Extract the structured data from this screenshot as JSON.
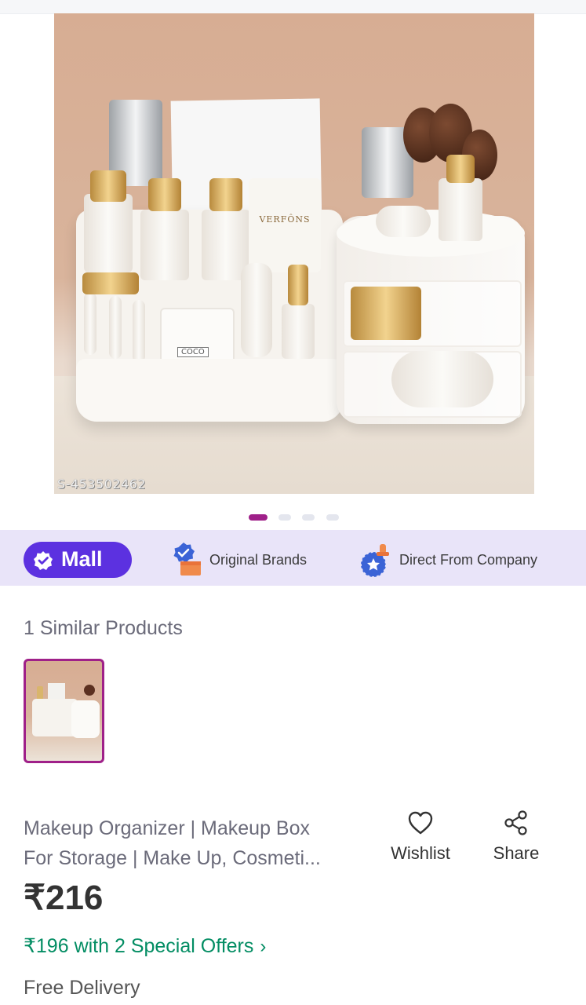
{
  "product_image": {
    "watermark": "S-453502462",
    "tube_label": "VERFÔNS",
    "box_label": "COCO"
  },
  "carousel": {
    "count": 4,
    "active_index": 0
  },
  "features_bar": {
    "mall_label": "Mall",
    "items": [
      {
        "icon": "verified-box-icon",
        "label": "Original Brands"
      },
      {
        "icon": "company-stamp-icon",
        "label": "Direct From Company"
      }
    ]
  },
  "similar": {
    "title": "1 Similar Products"
  },
  "product": {
    "title_line1": "Makeup Organizer | Makeup Box",
    "title_line2": "For Storage | Make Up, Cosmeti...",
    "price": "₹216",
    "offer": "₹196 with 2 Special Offers",
    "offer_chevron": "›",
    "delivery": "Free Delivery"
  },
  "actions": {
    "wishlist_label": "Wishlist",
    "share_label": "Share"
  },
  "colors": {
    "brand": "#9f2089",
    "mall": "#5c31e0",
    "offer_green": "#038d63",
    "feature_bar_bg": "#e9e4f9"
  }
}
